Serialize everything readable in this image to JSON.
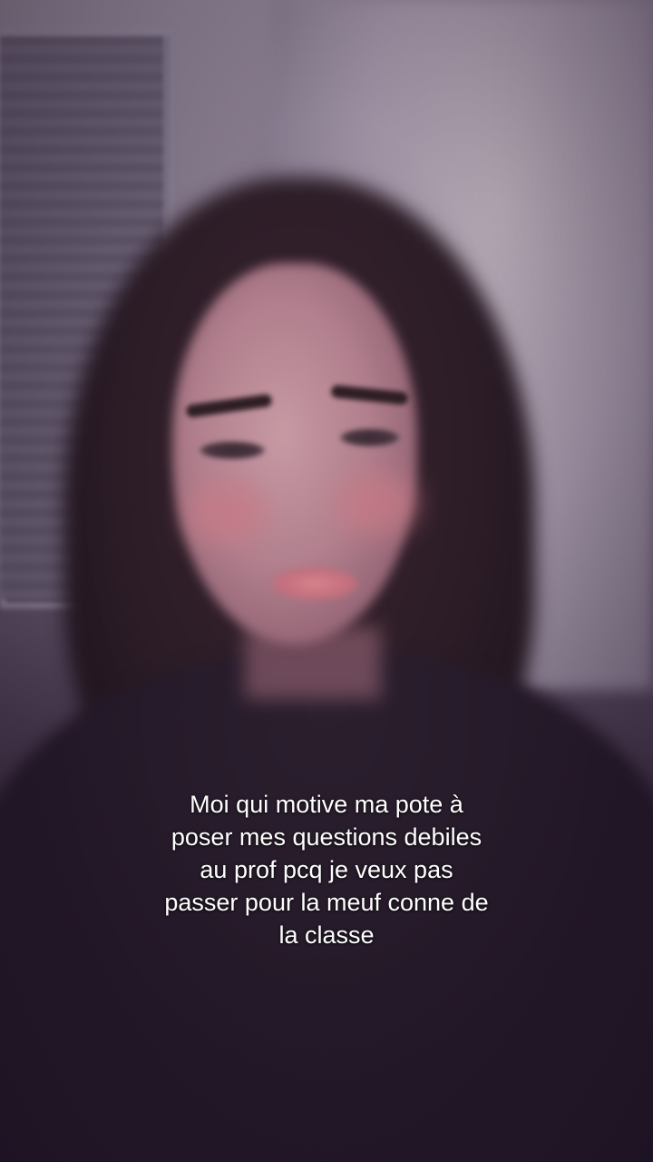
{
  "caption": {
    "lines": [
      "Moi qui motive ma pote à",
      "poser mes questions debiles",
      "au prof pcq je veux pas",
      "passer pour la meuf conne de",
      "la classe"
    ]
  },
  "colors": {
    "caption_text": "#ffffff",
    "sweater": "#241a2a",
    "wall": "#9a8ea0"
  }
}
